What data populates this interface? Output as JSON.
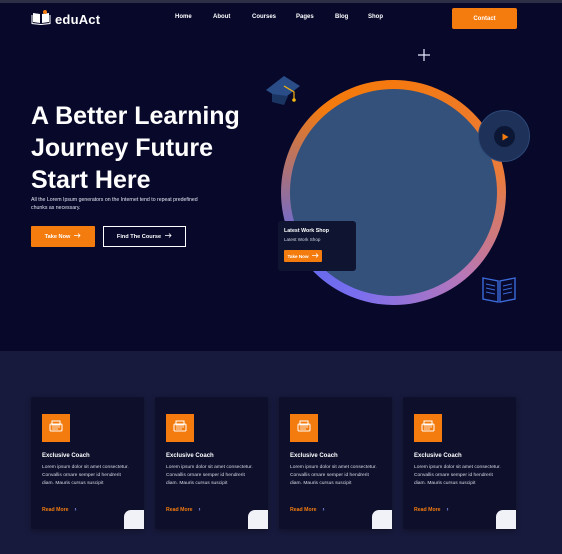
{
  "brand": {
    "name": "eduAct"
  },
  "nav": {
    "items": [
      {
        "label": "Home"
      },
      {
        "label": "About"
      },
      {
        "label": "Courses"
      },
      {
        "label": "Pages"
      },
      {
        "label": "Blog"
      },
      {
        "label": "Shop"
      }
    ],
    "contact_label": "Contact"
  },
  "hero": {
    "title_line1": "A Better Learning",
    "title_line2": "Journey Future",
    "title_line3": "Start Here",
    "description": "All the Lorem Ipsum generators on the Internet tend to repeat predefined chunks as necessary.",
    "primary_button": "Take Now",
    "secondary_button": "Find The Course"
  },
  "workshop": {
    "title": "Latest Work Shop",
    "subtitle": "Latest Work Shop",
    "button": "Take Now"
  },
  "cards": [
    {
      "title": "Exclusive Coach",
      "desc": "Lorem ipsum dolor sit amet consectetur. Convallis ornare semper id hendrerit diam. Mauris cursus suscipit",
      "link": "Read More"
    },
    {
      "title": "Exclusive Coach",
      "desc": "Lorem ipsum dolor sit amet consectetur. Convallis ornare semper id hendrerit diam. Mauris cursus suscipit",
      "link": "Read More"
    },
    {
      "title": "Exclusive Coach",
      "desc": "Lorem ipsum dolor sit amet consectetur. Convallis ornare semper id hendrerit diam. Mauris cursus suscipit",
      "link": "Read More"
    },
    {
      "title": "Exclusive Coach",
      "desc": "Lorem ipsum dolor sit amet consectetur. Convallis ornare semper id hendrerit diam. Mauris cursus suscipit",
      "link": "Read More"
    }
  ],
  "icons": {
    "logo": "open-book-icon",
    "arrow": "arrow-right-icon",
    "play": "play-icon",
    "card": "typewriter-icon",
    "decor_cap": "graduation-cap-icon",
    "decor_book": "open-book-icon",
    "decor_plus": "plus-icon",
    "chevron": "chevron-right-icon"
  },
  "colors": {
    "background": "#07082a",
    "accent": "#f47b0e",
    "section_background": "#181a3d",
    "card_background": "#0d0f2b",
    "circle_fill": "#33517a",
    "gradient_end": "#7a6ef0"
  }
}
